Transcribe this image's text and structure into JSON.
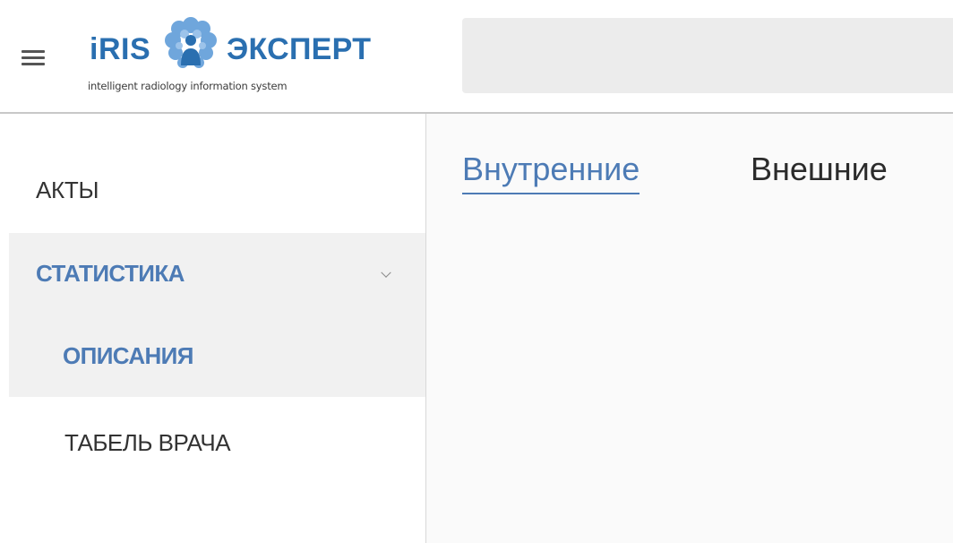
{
  "header": {
    "menu_icon": "hamburger-menu-icon",
    "logo": {
      "word_left": "iRIS",
      "word_right": "ЭКСПЕРТ",
      "tagline": "intelligent radiology information system",
      "mark_icon": "brain-person-logo-icon",
      "brand_color": "#2a6fb0"
    },
    "search": {
      "value": "",
      "placeholder": ""
    }
  },
  "sidebar": {
    "items": [
      {
        "label": "АКТЫ"
      },
      {
        "label": "СТАТИСТИКА",
        "expanded": true,
        "icon": "chevron-down-icon"
      },
      {
        "label": "ОПИСАНИЯ",
        "selected": true
      },
      {
        "label": "ТАБЕЛЬ ВРАЧА"
      }
    ],
    "active_color": "#4d7bb5",
    "highlight_bg": "#f1f1f1"
  },
  "main": {
    "tabs": [
      {
        "label": "Внутренние",
        "active": true
      },
      {
        "label": "Внешние",
        "active": false
      }
    ]
  }
}
